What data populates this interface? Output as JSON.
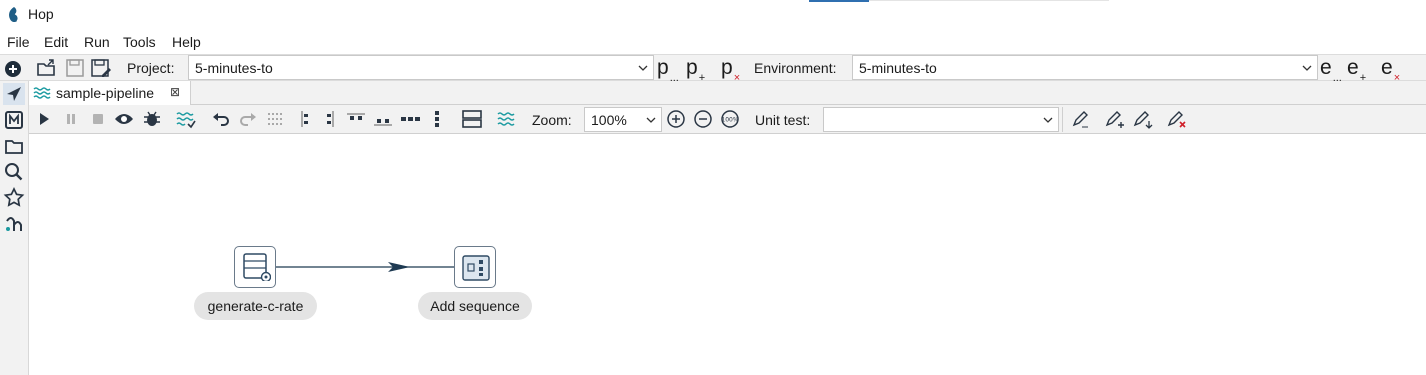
{
  "app": {
    "title": "Hop"
  },
  "menu": [
    "File",
    "Edit",
    "Run",
    "Tools",
    "Help"
  ],
  "toolbar": {
    "project_label": "Project:",
    "project_value": "5-minutes-to",
    "environment_label": "Environment:",
    "environment_value": "5-minutes-to",
    "project_buttons": [
      "p",
      "p",
      "p"
    ],
    "project_button_subs": [
      "...",
      "+",
      "×"
    ],
    "env_buttons": [
      "e",
      "e",
      "e"
    ],
    "env_button_subs": [
      "...",
      "+",
      "×"
    ]
  },
  "tab": {
    "label": "sample-pipeline",
    "close": "⊠"
  },
  "pipeline_toolbar": {
    "zoom_label": "Zoom:",
    "zoom_value": "100%",
    "unit_test_label": "Unit test:",
    "unit_test_value": ""
  },
  "pipeline": {
    "transforms": [
      {
        "name": "generate-c-rate",
        "icon": "row-generator-icon"
      },
      {
        "name": "Add sequence",
        "icon": "add-sequence-icon"
      }
    ],
    "hop": {
      "from": "generate-c-rate",
      "to": "Add sequence"
    }
  },
  "colors": {
    "accent": "#2f6fb0",
    "hop_line": "#1e3a52",
    "wave": "#1a9aa0",
    "red_x": "#d0202a",
    "node_border": "#6a7a8a",
    "label_bg": "#e4e4e4"
  }
}
